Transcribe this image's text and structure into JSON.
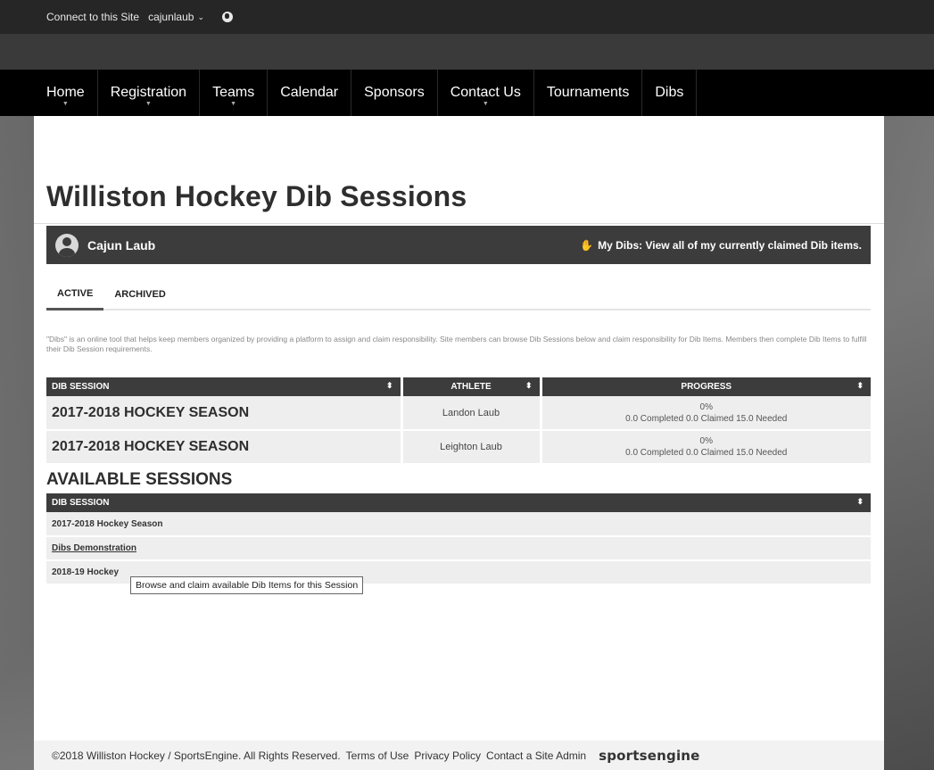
{
  "topbar": {
    "connect_label": "Connect to this Site",
    "user_label": "cajunlaub",
    "chevron": "⌄"
  },
  "nav": {
    "items": [
      {
        "label": "Home",
        "has_dropdown": true
      },
      {
        "label": "Registration",
        "has_dropdown": true
      },
      {
        "label": "Teams",
        "has_dropdown": true
      },
      {
        "label": "Calendar",
        "has_dropdown": false
      },
      {
        "label": "Sponsors",
        "has_dropdown": false
      },
      {
        "label": "Contact Us",
        "has_dropdown": true
      },
      {
        "label": "Tournaments",
        "has_dropdown": false
      },
      {
        "label": "Dibs",
        "has_dropdown": false
      }
    ]
  },
  "page": {
    "title": "Williston Hockey Dib Sessions"
  },
  "user": {
    "name": "Cajun Laub",
    "my_dibs_label": "My Dibs: View all of my currently claimed Dib items."
  },
  "tabs": [
    {
      "label": "ACTIVE",
      "active": true
    },
    {
      "label": "ARCHIVED",
      "active": false
    }
  ],
  "intro": "\"Dibs\" is an online tool that helps keep members organized by providing a platform to assign and claim responsibility. Site members can browse Dib Sessions below and claim responsibility for Dib Items. Members then complete Dib Items to fulfill their Dib Session requirements.",
  "active_table": {
    "headers": [
      "DIB SESSION",
      "ATHLETE",
      "PROGRESS"
    ],
    "rows": [
      {
        "session": "2017-2018 HOCKEY SEASON",
        "athlete": "Landon Laub",
        "percent": "0%",
        "detail": "0.0 Completed 0.0 Claimed 15.0 Needed"
      },
      {
        "session": "2017-2018 HOCKEY SEASON",
        "athlete": "Leighton Laub",
        "percent": "0%",
        "detail": "0.0 Completed 0.0 Claimed 15.0 Needed"
      }
    ]
  },
  "available": {
    "title": "AVAILABLE SESSIONS",
    "header": "DIB SESSION",
    "rows": [
      "2017-2018 Hockey Season",
      "Dibs Demonstration",
      "2018-19 Hockey"
    ]
  },
  "tooltip": "Browse and claim available Dib Items for this Session",
  "footer": {
    "copyright": "©2018 Williston Hockey / SportsEngine. All Rights Reserved.",
    "terms": "Terms of Use",
    "privacy": "Privacy Policy",
    "contact": "Contact a Site Admin",
    "brand": "sportsengine"
  },
  "sort_glyph": "⬍"
}
